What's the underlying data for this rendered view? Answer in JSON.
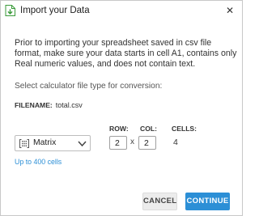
{
  "window": {
    "title": "Import your Data",
    "close_glyph": "✕"
  },
  "intro_text": "Prior to importing your spreadsheet saved in csv file format, make sure your data starts in cell A1, contains only Real numeric values, and does not contain text.",
  "select_label": "Select calculator file type for conversion:",
  "file": {
    "label": "FILENAME:",
    "value": "total.csv"
  },
  "form": {
    "file_type": {
      "selected": "Matrix",
      "icon": "matrix-icon"
    },
    "row_label": "ROW:",
    "row_value": "2",
    "col_label": "COL:",
    "col_value": "2",
    "times_sign": "x",
    "cells_label": "CELLS:",
    "cells_value": "4"
  },
  "limit_note": "Up to 400 cells",
  "buttons": {
    "cancel": "CANCEL",
    "continue": "CONTINUE"
  },
  "colors": {
    "accent": "#2c8fd6",
    "app_icon_green": "#3a9a3a",
    "cancel_bg": "#ececec"
  }
}
